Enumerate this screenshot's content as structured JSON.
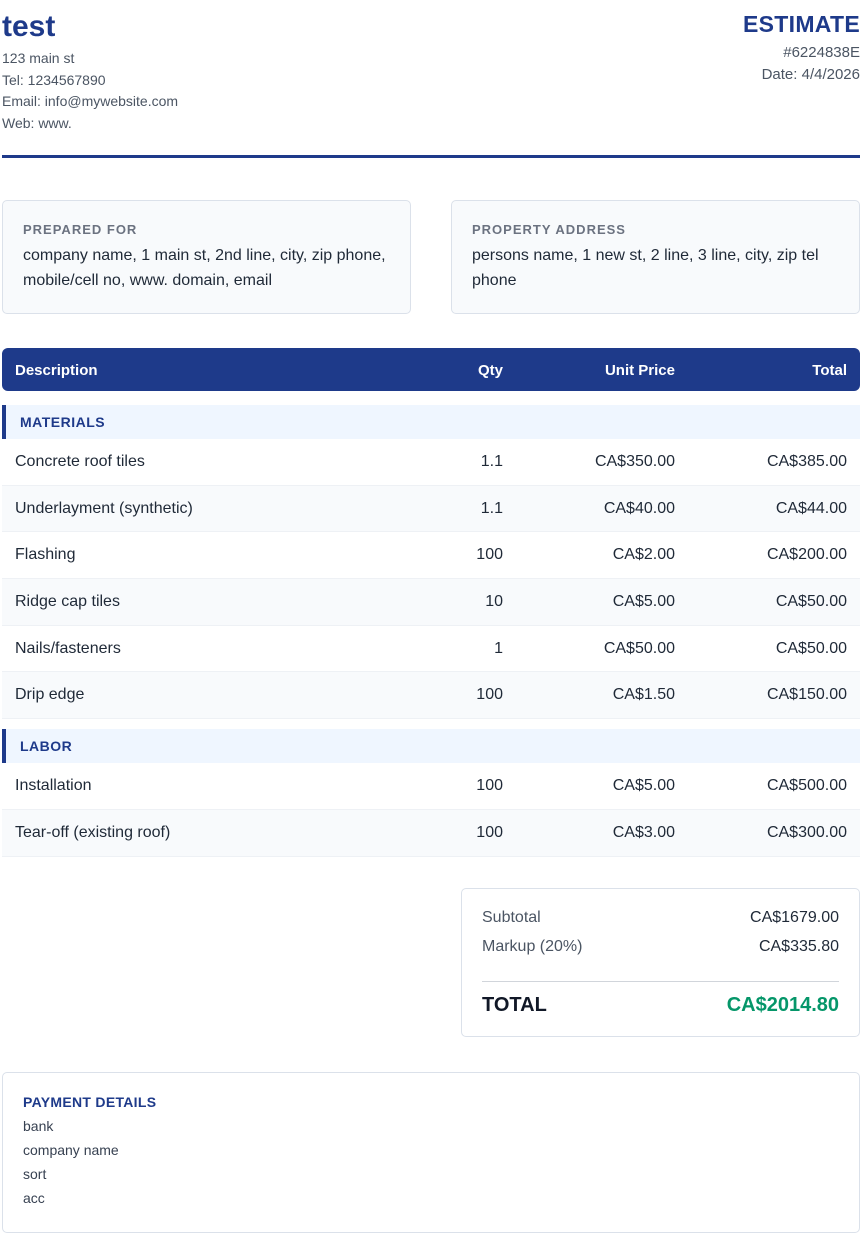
{
  "company": {
    "name": "test",
    "address": "123 main st",
    "tel": "Tel: 1234567890",
    "email": "Email: info@mywebsite.com",
    "web": "Web: www."
  },
  "document": {
    "title": "ESTIMATE",
    "number": "#6224838E",
    "date": "Date: 4/4/2026"
  },
  "prepared_for": {
    "label": "PREPARED FOR",
    "text": "company name, 1 main st, 2nd line, city, zip phone, mobile/cell no, www. domain, email"
  },
  "property_address": {
    "label": "PROPERTY ADDRESS",
    "text": "persons name, 1 new st, 2 line, 3 line, city, zip tel phone"
  },
  "table": {
    "headers": {
      "description": "Description",
      "qty": "Qty",
      "unit_price": "Unit Price",
      "total": "Total"
    },
    "sections": [
      {
        "title": "MATERIALS",
        "items": [
          {
            "description": "Concrete roof tiles",
            "qty": "1.1",
            "unit_price": "CA$350.00",
            "total": "CA$385.00"
          },
          {
            "description": "Underlayment (synthetic)",
            "qty": "1.1",
            "unit_price": "CA$40.00",
            "total": "CA$44.00"
          },
          {
            "description": "Flashing",
            "qty": "100",
            "unit_price": "CA$2.00",
            "total": "CA$200.00"
          },
          {
            "description": "Ridge cap tiles",
            "qty": "10",
            "unit_price": "CA$5.00",
            "total": "CA$50.00"
          },
          {
            "description": "Nails/fasteners",
            "qty": "1",
            "unit_price": "CA$50.00",
            "total": "CA$50.00"
          },
          {
            "description": "Drip edge",
            "qty": "100",
            "unit_price": "CA$1.50",
            "total": "CA$150.00"
          }
        ]
      },
      {
        "title": "LABOR",
        "items": [
          {
            "description": "Installation",
            "qty": "100",
            "unit_price": "CA$5.00",
            "total": "CA$500.00"
          },
          {
            "description": "Tear-off (existing roof)",
            "qty": "100",
            "unit_price": "CA$3.00",
            "total": "CA$300.00"
          }
        ]
      }
    ]
  },
  "totals": {
    "subtotal_label": "Subtotal",
    "subtotal": "CA$1679.00",
    "markup_label": "Markup (20%)",
    "markup": "CA$335.80",
    "total_label": "TOTAL",
    "total": "CA$2014.80"
  },
  "payment": {
    "title": "PAYMENT DETAILS",
    "lines": [
      "bank",
      "company name",
      "sort",
      "acc"
    ]
  },
  "colors": {
    "brand": "#1e3a8a",
    "total_accent": "#059669"
  }
}
